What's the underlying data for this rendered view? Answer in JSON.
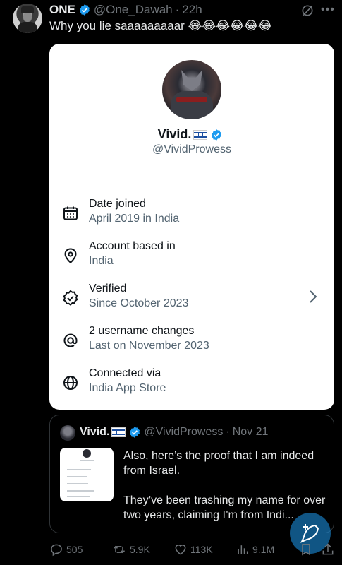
{
  "post": {
    "author_name": "ONE",
    "handle": "@One_Dawah",
    "separator": "·",
    "time": "22h",
    "text": "Why you lie saaaaaaaaar 😂😂😂😂😂😂"
  },
  "card": {
    "name": "Vivid.",
    "handle": "@VividProwess",
    "rows": [
      {
        "label": "Date joined",
        "value": "April 2019 in India",
        "icon": "calendar-icon"
      },
      {
        "label": "Account based in",
        "value": "India",
        "icon": "location-icon"
      },
      {
        "label": "Verified",
        "value": "Since October 2023",
        "icon": "verified-badge-icon"
      },
      {
        "label": "2 username changes",
        "value": "Last on November 2023",
        "icon": "at-icon"
      },
      {
        "label": "Connected via",
        "value": "India App Store",
        "icon": "globe-icon"
      }
    ]
  },
  "quote": {
    "name": "Vivid.",
    "handle": "@VividProwess",
    "separator": "·",
    "date": "Nov 21",
    "text_p1": "Also, here’s the proof that I am indeed from Israel.",
    "text_p2": "They’ve been trashing my name for over two years, claiming I’m from Indi..."
  },
  "actions": {
    "replies": "505",
    "reposts": "5.9K",
    "likes": "113K",
    "views": "9.1M"
  },
  "colors": {
    "background": "#000000",
    "text": "#e7e9ea",
    "muted": "#71767b",
    "verified": "#1d9bf0",
    "card_bg": "#ffffff"
  }
}
